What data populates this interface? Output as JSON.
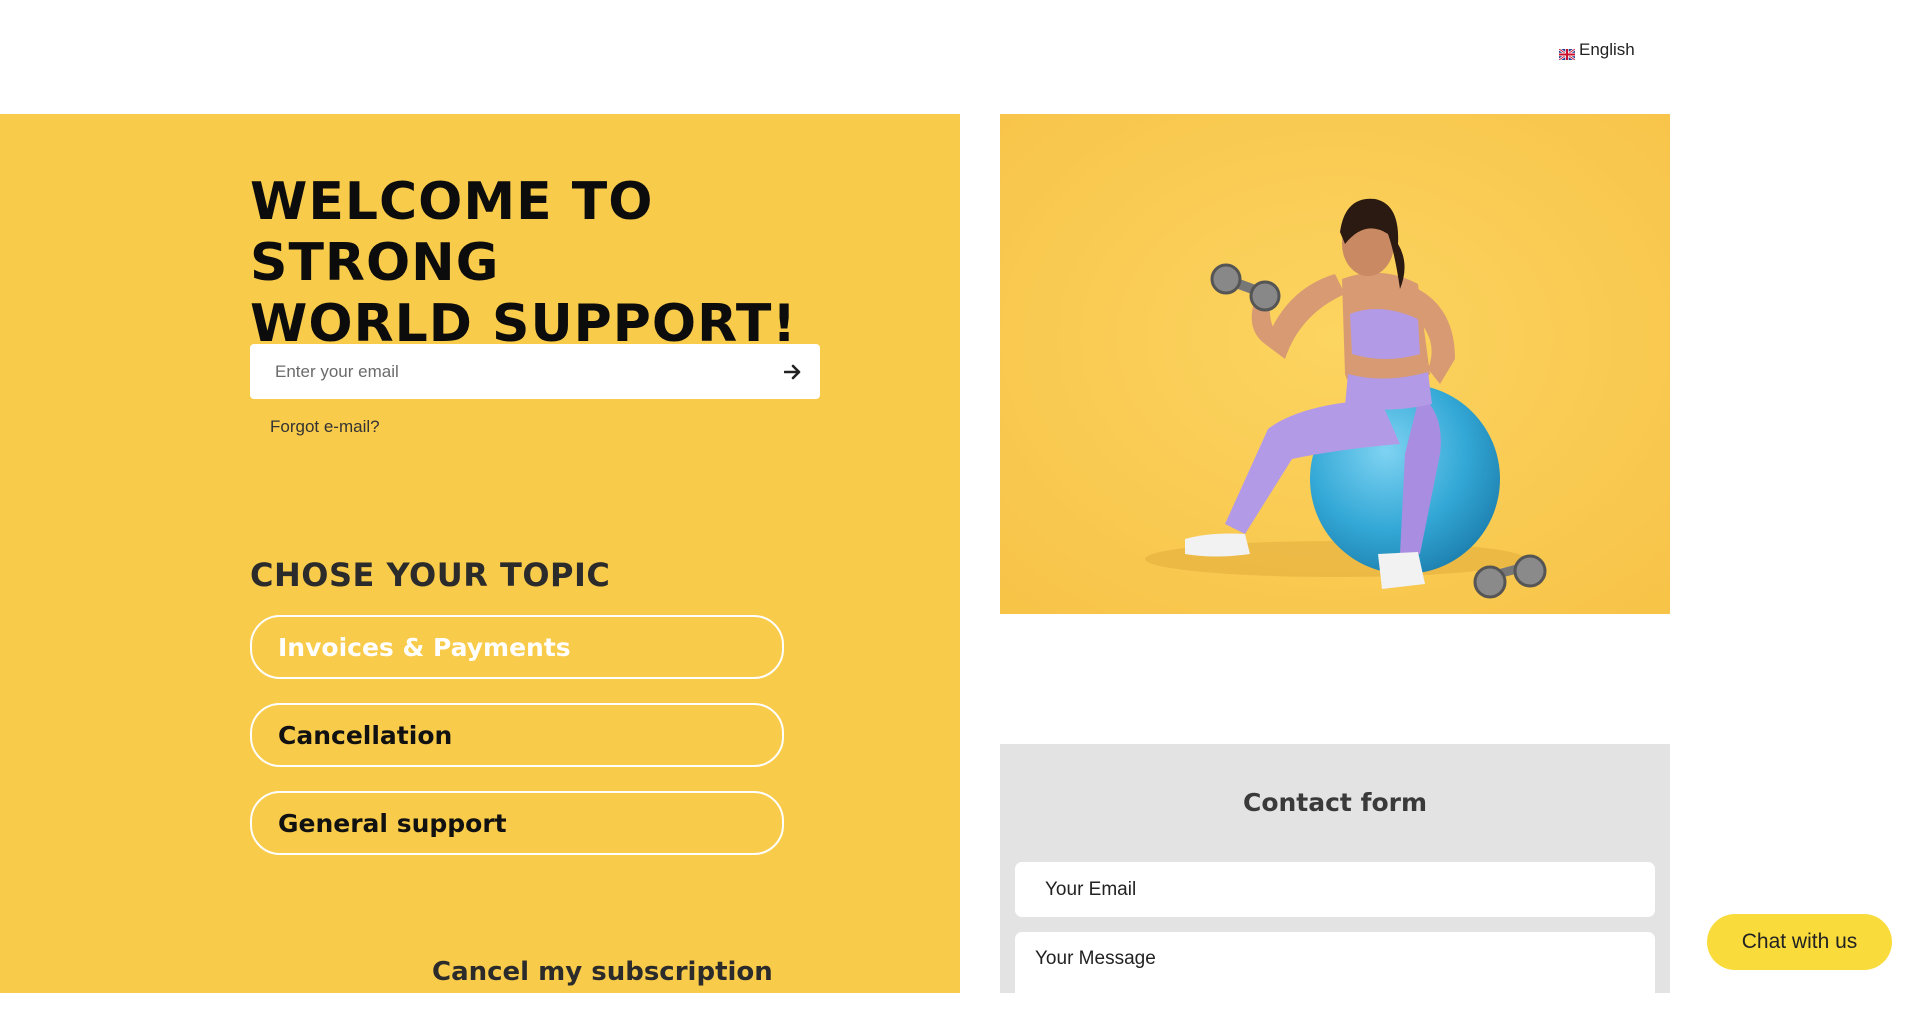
{
  "language": {
    "label": "English",
    "icon": "uk-flag-icon"
  },
  "hero_left": {
    "title": "WELCOME TO STRONG\nWORLD SUPPORT!",
    "email_placeholder": "Enter your email",
    "submit_icon": "arrow-right-icon",
    "forgot_label": "Forgot e-mail?"
  },
  "topics": {
    "heading": "CHOSE YOUR TOPIC",
    "items": [
      {
        "label": "Invoices & Payments",
        "active": true
      },
      {
        "label": "Cancellation",
        "active": false
      },
      {
        "label": "General support",
        "active": false
      }
    ]
  },
  "cancel_subscription": "Cancel my subscription",
  "contact_form": {
    "title": "Contact form",
    "email_placeholder": "Your Email",
    "message_placeholder": "Your Message"
  },
  "chat": {
    "label": "Chat with us"
  },
  "colors": {
    "brand_yellow": "#f8cb4b",
    "chat_yellow": "#f9dc3c",
    "form_gray": "#e3e3e3",
    "outfit_lilac": "#b39ae6",
    "ball_blue": "#3aaed8"
  }
}
